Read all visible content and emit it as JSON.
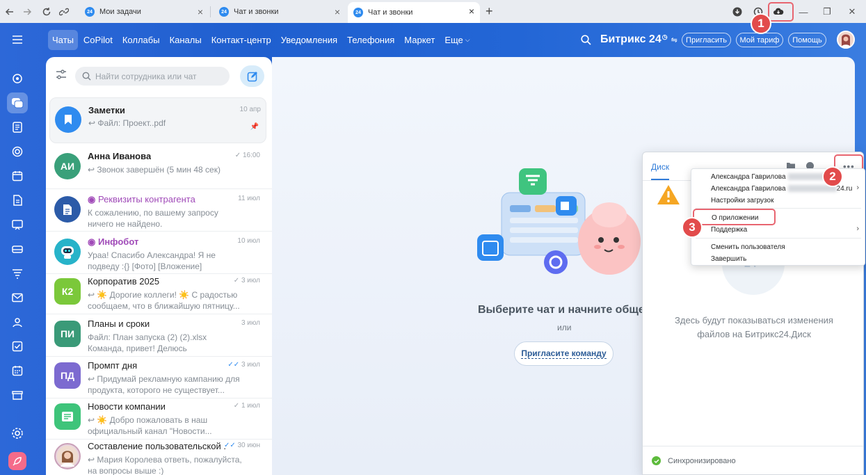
{
  "browser": {
    "tabs": [
      {
        "title": "Мои задачи"
      },
      {
        "title": "Чат и звонки"
      },
      {
        "title": "Чат и звонки"
      }
    ],
    "favicon_text": "24"
  },
  "top_menu": {
    "items": [
      "Чаты",
      "CoPilot",
      "Коллабы",
      "Каналы",
      "Контакт-центр",
      "Уведомления",
      "Телефония",
      "Маркет",
      "Еще"
    ],
    "brand": "Битрикс 24",
    "invite": "Пригласить",
    "tariff": "Мой тариф",
    "help": "Помощь"
  },
  "search": {
    "placeholder": "Найти сотрудника или чат"
  },
  "chats": [
    {
      "title": "Заметки",
      "date": "10 апр",
      "message": "↩ Файл: Проект..pdf",
      "avatar": "",
      "color": "#2f8bef"
    },
    {
      "title": "Анна Иванова",
      "date": "16:00",
      "message": "↩ Звонок завершён (5 мин 48 сек)",
      "avatar": "АИ",
      "color": "#3aa07a"
    },
    {
      "title": "Реквизиты контрагента",
      "date": "11 июл",
      "message": "К сожалению, по вашему запросу ничего не найдено.",
      "avatar": "",
      "color": "#2c5ba8"
    },
    {
      "title": "Инфобот",
      "date": "10 июл",
      "message": "Ураа! Спасибо Александра! Я не подведу :{} [Фото] [Вложение]",
      "avatar": "",
      "color": "#27b3c9"
    },
    {
      "title": "Корпоратив 2025",
      "date": "3 июл",
      "message": "↩ ☀️ Дорогие коллеги! ☀️ С радостью сообщаем, что в ближайшую пятницу...",
      "avatar": "К2",
      "color": "#7bc83a"
    },
    {
      "title": "Планы и сроки",
      "date": "3 июл",
      "message": "Файл: План запуска (2) (2).xlsx Команда, привет! Делюсь обновлённым...",
      "avatar": "ПИ",
      "color": "#3a9a78"
    },
    {
      "title": "Промпт дня",
      "date": "3 июл",
      "message": "↩ Придумай рекламную кампанию для продукта, которого не существует...",
      "avatar": "ПД",
      "color": "#7c6ad0"
    },
    {
      "title": "Новости компании",
      "date": "1 июл",
      "message": "↩ ☀️ Добро пожаловать в наш официальный канал \"Новости...",
      "avatar": "",
      "color": "#3ec47a"
    },
    {
      "title": "Составление пользовательской ...",
      "date": "30 июн",
      "message": "↩ Мария Королева ответь, пожалуйста, на вопросы выше :)",
      "avatar": "",
      "color": "#c9a0b8"
    }
  ],
  "empty_state": {
    "title": "Выберите чат и начните общени",
    "or": "или",
    "invite_button": "Пригласите команду"
  },
  "disk": {
    "tab": "Диск",
    "empty_text": "Здесь будут показываться изменения файлов на Битрикс24.Диск",
    "status": "Синхронизировано"
  },
  "menu": {
    "user1": "Александра Гаврилова",
    "user2": "Александра Гаврилова",
    "user2_suffix": "24.ru",
    "downloads": "Настройки загрузок",
    "about": "О приложении",
    "support": "Поддержка",
    "switch_user": "Сменить пользователя",
    "exit": "Завершить"
  },
  "annotations": [
    "1",
    "2",
    "3"
  ],
  "colors": {
    "accent": "#2366d6",
    "badge": "#e24b4b",
    "link": "#2f7bd8"
  }
}
